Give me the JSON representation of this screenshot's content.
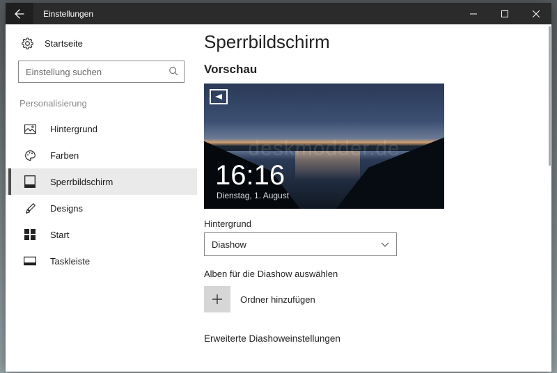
{
  "titlebar": {
    "title": "Einstellungen"
  },
  "sidebar": {
    "home": "Startseite",
    "search_placeholder": "Einstellung suchen",
    "section": "Personalisierung",
    "items": [
      {
        "label": "Hintergrund"
      },
      {
        "label": "Farben"
      },
      {
        "label": "Sperrbildschirm"
      },
      {
        "label": "Designs"
      },
      {
        "label": "Start"
      },
      {
        "label": "Taskleiste"
      }
    ]
  },
  "main": {
    "heading": "Sperrbildschirm",
    "preview_label": "Vorschau",
    "preview": {
      "time": "16:16",
      "date": "Dienstag, 1. August",
      "watermark": "deskmodder.de"
    },
    "bg_field_label": "Hintergrund",
    "bg_select_value": "Diashow",
    "albums_label": "Alben für die Diashow auswählen",
    "add_folder_label": "Ordner hinzufügen",
    "advanced_label": "Erweiterte Diashoweinstellungen"
  }
}
